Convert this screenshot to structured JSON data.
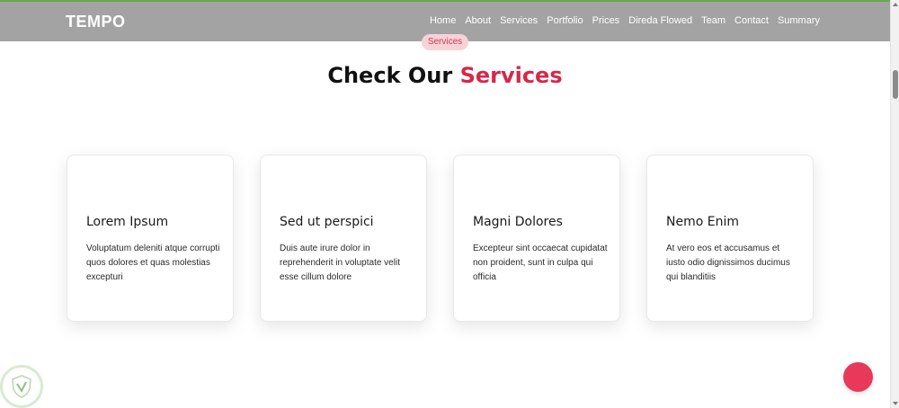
{
  "header": {
    "logo": "TEMPO",
    "nav": [
      "Home",
      "About",
      "Services",
      "Portfolio",
      "Prices",
      "Direda Flowed",
      "Team",
      "Contact",
      "Summary"
    ]
  },
  "section": {
    "badge": "Services",
    "title_main": "Check Our",
    "title_accent": "Services"
  },
  "cards": [
    {
      "title": "Lorem Ipsum",
      "text": "Voluptatum deleniti atque corrupti quos dolores et quas molestias excepturi"
    },
    {
      "title": "Sed ut perspici",
      "text": "Duis aute irure dolor in reprehenderit in voluptate velit esse cillum dolore"
    },
    {
      "title": "Magni Dolores",
      "text": "Excepteur sint occaecat cupidatat non proident, sunt in culpa qui officia"
    },
    {
      "title": "Nemo Enim",
      "text": "At vero eos et accusamus et iusto odio dignissimos ducimus qui blanditiis"
    }
  ],
  "colors": {
    "accent": "#d6284a",
    "header_bg": "#a3a3a3",
    "fab": "#e8395a"
  },
  "icons": {
    "fab": "scroll-top-icon",
    "badge": "shield-logo-icon"
  }
}
